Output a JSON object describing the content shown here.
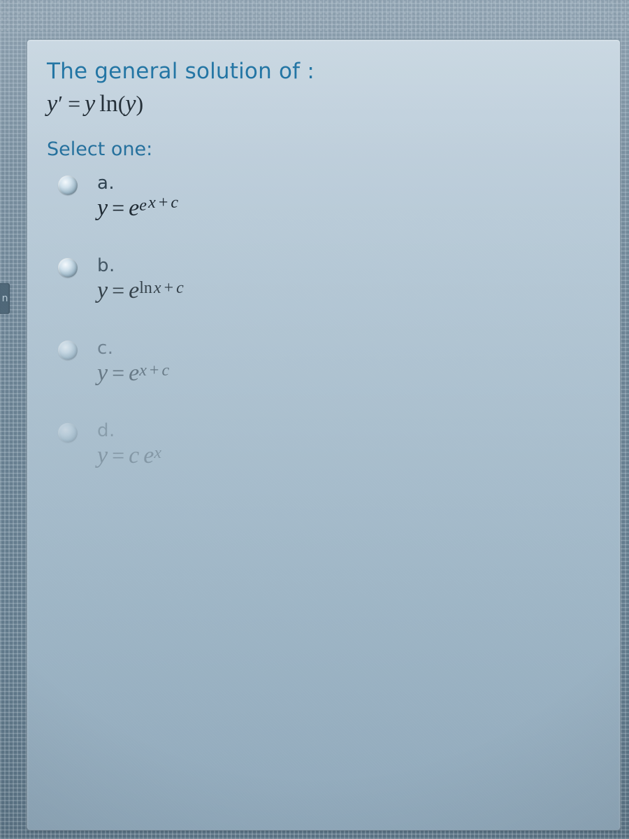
{
  "edge_tab_glyph": "n",
  "question": {
    "title": "The general solution of :",
    "equation_plain": "y' = y ln(y)"
  },
  "prompt": "Select one:",
  "options": [
    {
      "letter": "a.",
      "answer_plain": "y = e^{e^{x+c}}"
    },
    {
      "letter": "b.",
      "answer_plain": "y = e^{ln x + c}"
    },
    {
      "letter": "c.",
      "answer_plain": "y = e^{x + c}"
    },
    {
      "letter": "d.",
      "answer_plain": "y = c e^{x}"
    }
  ]
}
